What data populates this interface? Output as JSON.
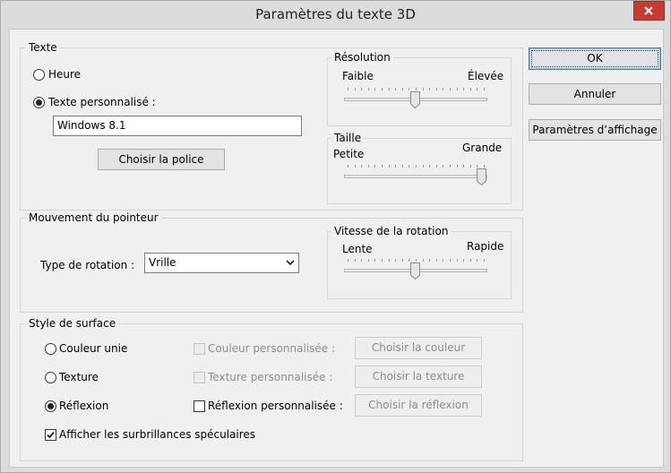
{
  "window": {
    "title": "Paramètres du texte 3D"
  },
  "texte": {
    "group_title": "Texte",
    "option_heure": "Heure",
    "option_custom": "Texte personnalisé :",
    "selected": "custom",
    "custom_value": "Windows 8.1",
    "font_button": "Choisir la police",
    "resolution": {
      "title": "Résolution",
      "min_label": "Faible",
      "max_label": "Élevée",
      "level": 0.5
    },
    "taille": {
      "title": "Taille",
      "min_label": "Petite",
      "max_label": "Grande",
      "level": 1.0
    }
  },
  "mouvement": {
    "group_title": "Mouvement du pointeur",
    "rotation_label": "Type de rotation :",
    "rotation_value": "Vrille",
    "vitesse": {
      "title": "Vitesse de la rotation",
      "min_label": "Lente",
      "max_label": "Rapide",
      "level": 0.5
    }
  },
  "surface": {
    "group_title": "Style de surface",
    "options": [
      {
        "label": "Couleur unie",
        "checked": false
      },
      {
        "label": "Texture",
        "checked": false
      },
      {
        "label": "Réflexion",
        "checked": true
      }
    ],
    "custom_checks": [
      {
        "label": "Couleur personnalisée :",
        "enabled": false,
        "checked": false
      },
      {
        "label": "Texture personnalisée :",
        "enabled": false,
        "checked": false
      },
      {
        "label": "Réflexion personnalisée :",
        "enabled": true,
        "checked": false
      }
    ],
    "choose_buttons": [
      "Choisir la couleur",
      "Choisir la texture",
      "Choisir la réflexion"
    ],
    "specular_label": "Afficher les surbrillances spéculaires",
    "specular_checked": true
  },
  "buttons": {
    "ok": "OK",
    "annuler": "Annuler",
    "affichage": "Paramètres d’affichage"
  },
  "colors": {
    "close": "#c73b33",
    "window": "#dcdcdc",
    "client": "#f0f0f0"
  }
}
